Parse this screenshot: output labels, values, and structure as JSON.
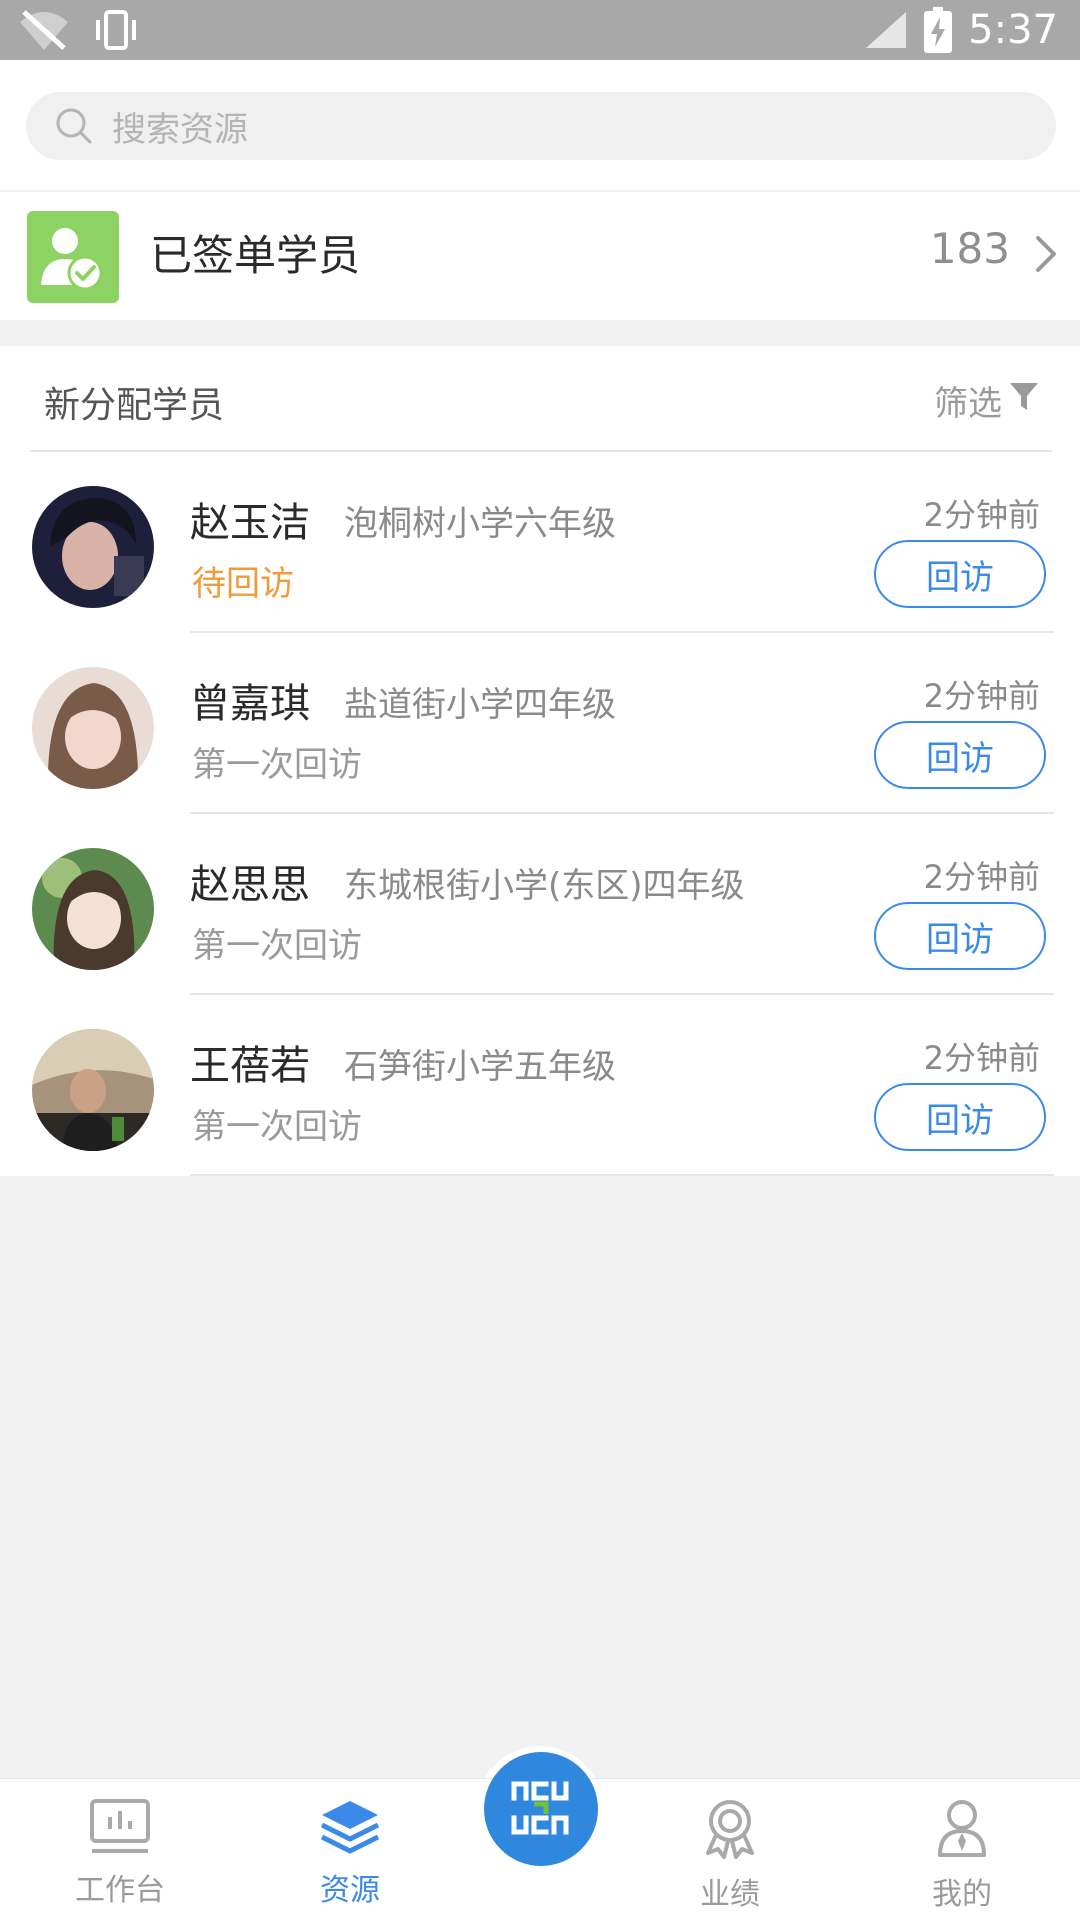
{
  "status_bar": {
    "time": "5:37"
  },
  "search": {
    "placeholder": "搜索资源"
  },
  "signed": {
    "label": "已签单学员",
    "count": "183"
  },
  "section": {
    "title": "新分配学员",
    "filter_label": "筛选"
  },
  "students": [
    {
      "name": "赵玉洁",
      "school": "泡桐树小学六年级",
      "status": "待回访",
      "status_color": "#f29a38",
      "time": "2分钟前",
      "button": "回访"
    },
    {
      "name": "曾嘉琪",
      "school": "盐道街小学四年级",
      "status": "第一次回访",
      "status_color": "#9a9a9a",
      "time": "2分钟前",
      "button": "回访"
    },
    {
      "name": "赵思思",
      "school": "东城根街小学(东区)四年级",
      "status": "第一次回访",
      "status_color": "#9a9a9a",
      "time": "2分钟前",
      "button": "回访"
    },
    {
      "name": "王蓓若",
      "school": "石笋街小学五年级",
      "status": "第一次回访",
      "status_color": "#9a9a9a",
      "time": "2分钟前",
      "button": "回访"
    }
  ],
  "nav": {
    "items": [
      {
        "label": "工作台",
        "icon": "dashboard-icon"
      },
      {
        "label": "资源",
        "icon": "layers-icon",
        "active": true
      },
      {
        "label": "业绩",
        "icon": "medal-icon"
      },
      {
        "label": "我的",
        "icon": "profile-icon"
      }
    ],
    "center_icon": "logo-icon"
  },
  "colors": {
    "accent": "#3b8aea",
    "pending": "#f29a38",
    "signed_icon_bg": "#8cd363"
  }
}
